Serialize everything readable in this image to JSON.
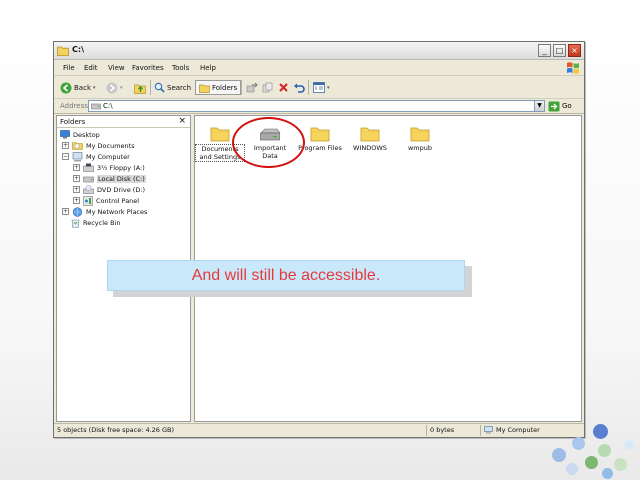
{
  "window": {
    "title": "C:\\",
    "controls": {
      "minimize": "_",
      "maximize": "□",
      "close": "×"
    }
  },
  "menu": [
    "File",
    "Edit",
    "View",
    "Favorites",
    "Tools",
    "Help"
  ],
  "toolbar": {
    "back": "Back",
    "search": "Search",
    "folders": "Folders"
  },
  "address": {
    "label": "Address",
    "value": "C:\\",
    "go": "Go"
  },
  "folders_pane": {
    "title": "Folders",
    "close": "×",
    "tree": {
      "desktop": "Desktop",
      "my_documents": "My Documents",
      "my_computer": "My Computer",
      "floppy": "3½ Floppy (A:)",
      "local_disk": "Local Disk (C:)",
      "dvd": "DVD Drive (D:)",
      "control_panel": "Control Panel",
      "network": "My Network Places",
      "recycle": "Recycle Bin"
    }
  },
  "files": {
    "documents_line1": "Documents",
    "documents_line2": "and Settings",
    "important_line1": "Important",
    "important_line2": "Data",
    "program_files": "Program Files",
    "windows": "WINDOWS",
    "wmpub": "wmpub"
  },
  "status": {
    "objects": "5 objects (Disk free space: 4.26 GB)",
    "size": "0 bytes",
    "location": "My Computer"
  },
  "caption": "And will still be accessible.",
  "colors": {
    "annotation_circle": "#d40f0f",
    "caption_background": "#c9e9fb",
    "caption_text": "#e7383c"
  }
}
